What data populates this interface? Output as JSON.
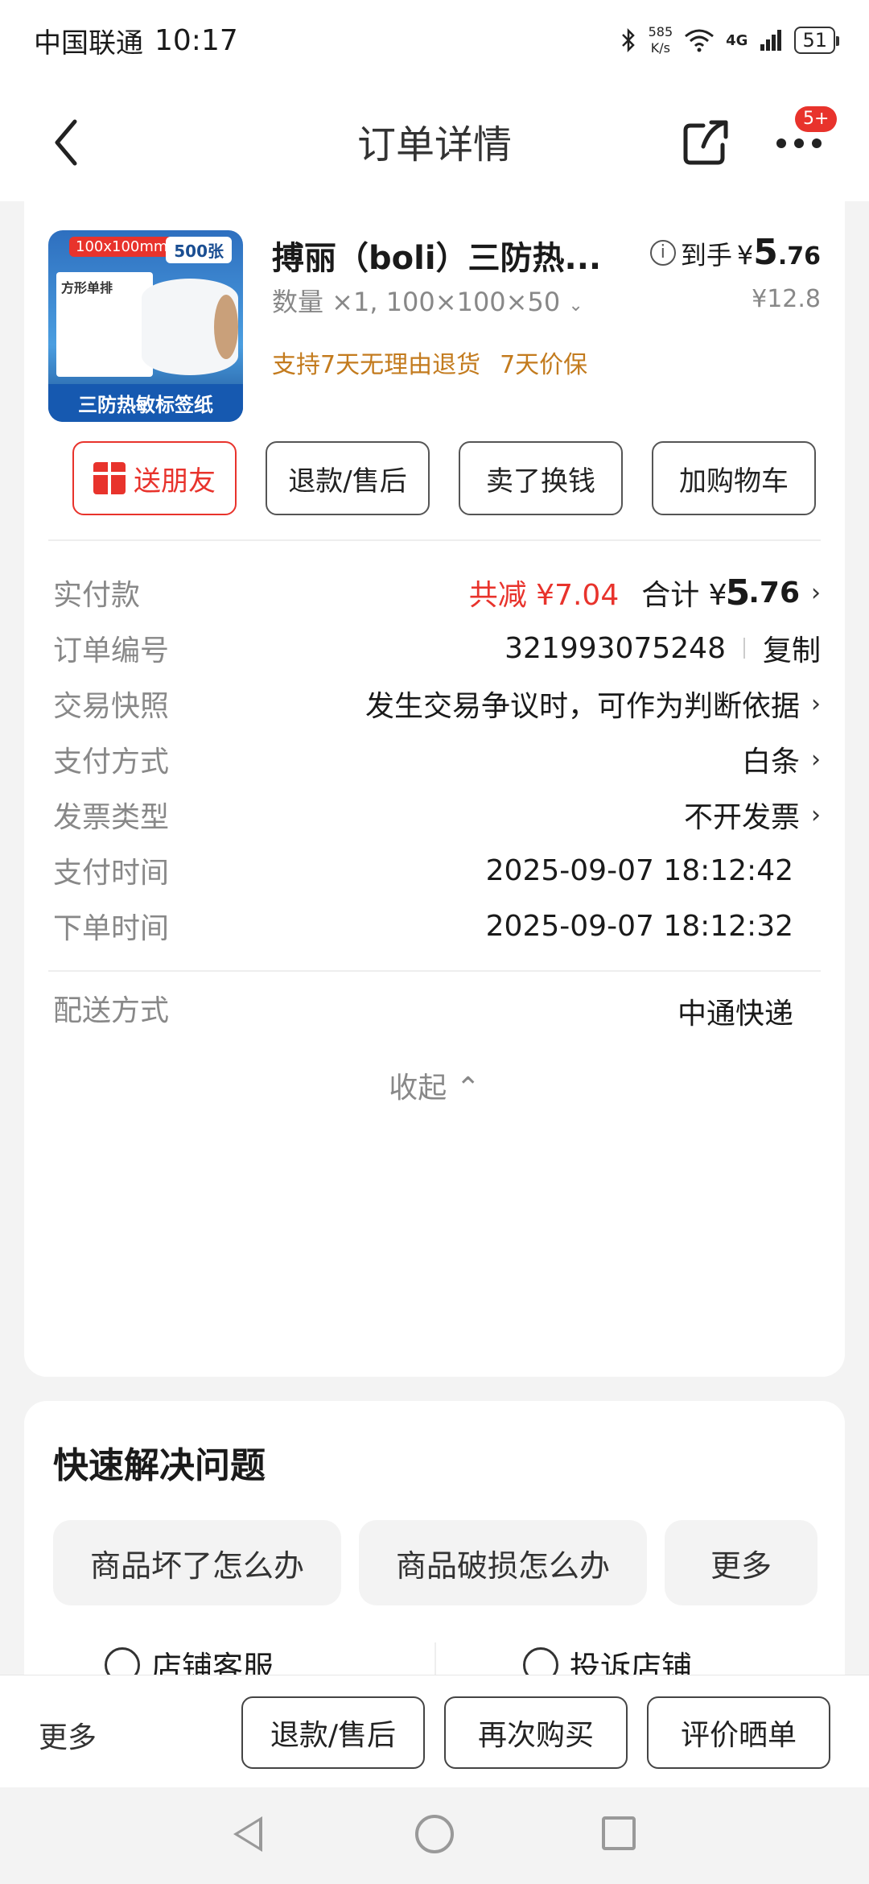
{
  "status_bar": {
    "carrier": "中国联通",
    "time": "10:17",
    "net_speed_value": "585",
    "net_speed_unit": "K/s",
    "network": "4G",
    "battery": "51"
  },
  "nav": {
    "title": "订单详情",
    "badge": "5+"
  },
  "product": {
    "image": {
      "tag_size": "100x100mm",
      "tag_count": "500张",
      "label_text": "方形单排",
      "bottom_text": "三防热敏标签纸"
    },
    "title": "搏丽（boli）三防热...",
    "price_prefix": "到手",
    "price_currency": "¥",
    "price_int": "5",
    "price_dec": ".76",
    "spec": "数量 ×1, 100×100×50",
    "original_price": "¥12.8",
    "tags": [
      "支持7天无理由退货",
      "7天价保"
    ]
  },
  "actions": {
    "gift": "送朋友",
    "refund": "退款/售后",
    "sell": "卖了换钱",
    "cart": "加购物车"
  },
  "details": {
    "paid": {
      "label": "实付款",
      "reduce": "共减 ¥7.04",
      "total_label": "合计 ¥",
      "total_int": "5",
      "total_dec": ".76"
    },
    "order_no": {
      "label": "订单编号",
      "value": "321993075248",
      "copy": "复制"
    },
    "snapshot": {
      "label": "交易快照",
      "value": "发生交易争议时，可作为判断依据"
    },
    "payment_method": {
      "label": "支付方式",
      "value": "白条"
    },
    "invoice": {
      "label": "发票类型",
      "value": "不开发票"
    },
    "pay_time": {
      "label": "支付时间",
      "value": "2025-09-07 18:12:42"
    },
    "order_time": {
      "label": "下单时间",
      "value": "2025-09-07 18:12:32"
    },
    "delivery": {
      "label": "配送方式",
      "value": "中通快递"
    },
    "collapse": "收起 ⌃"
  },
  "help": {
    "title": "快速解决问题",
    "chips": [
      "商品坏了怎么办",
      "商品破损怎么办",
      "更多"
    ],
    "service_left": "店铺客服",
    "service_right": "投诉店铺"
  },
  "bottom_bar": {
    "more": "更多",
    "refund": "退款/售后",
    "rebuy": "再次购买",
    "review": "评价晒单"
  }
}
